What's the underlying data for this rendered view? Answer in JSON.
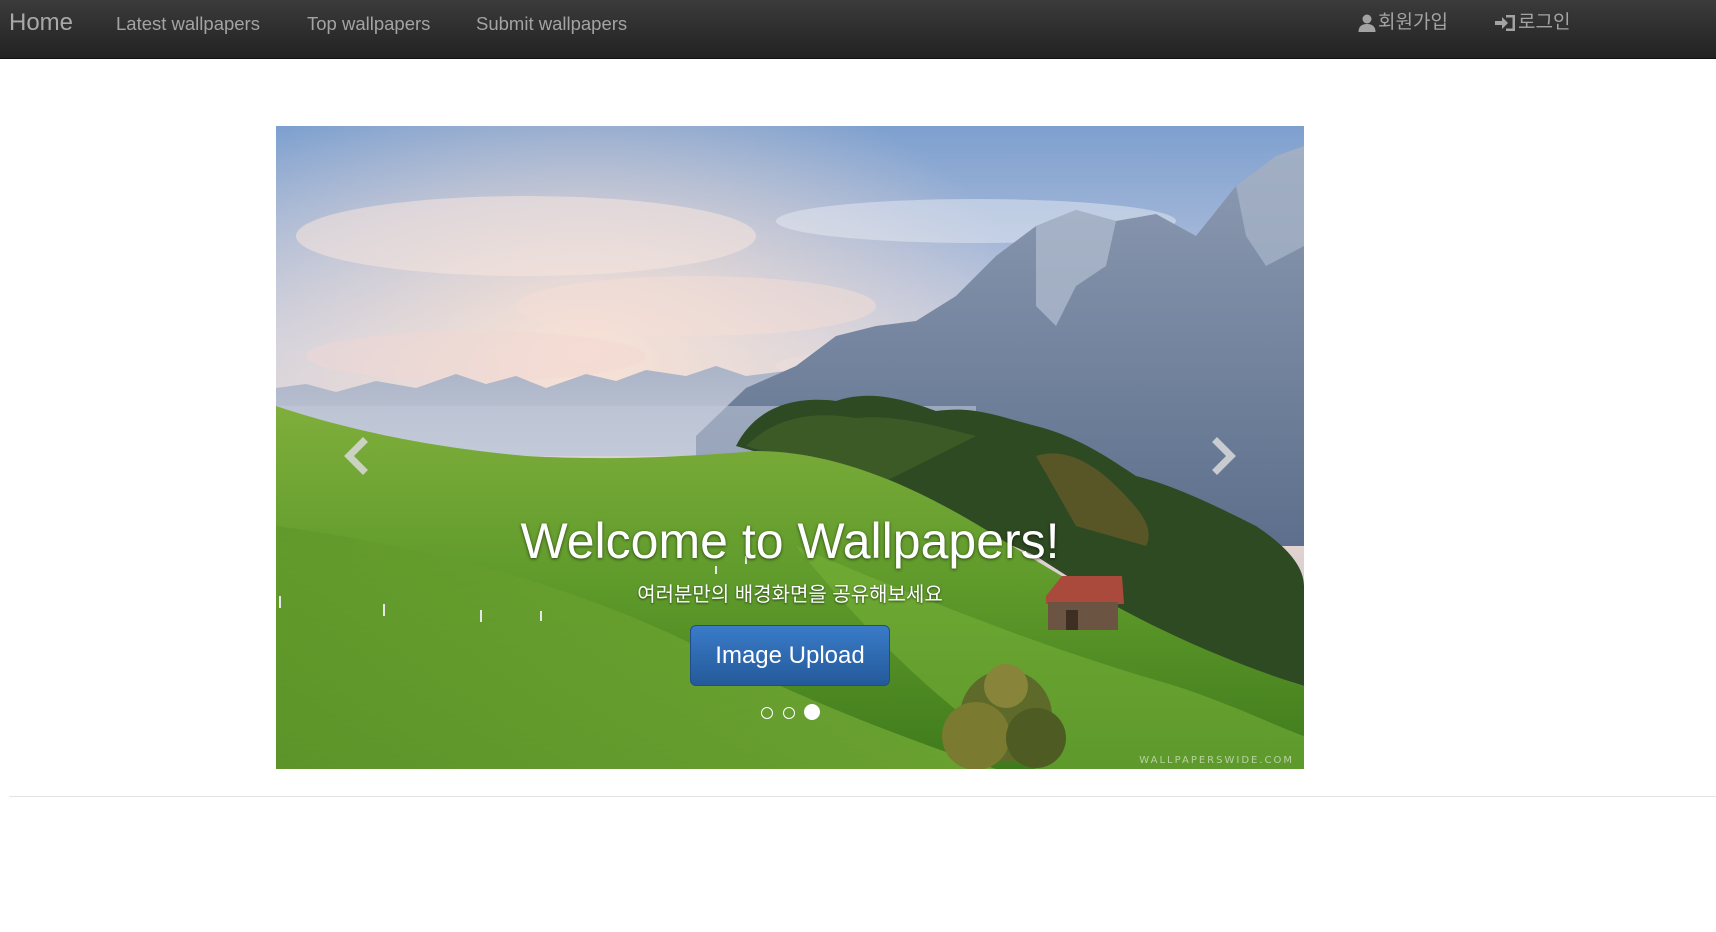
{
  "navbar": {
    "brand": "Home",
    "links": [
      "Latest wallpapers",
      "Top wallpapers",
      "Submit wallpapers"
    ],
    "signup": {
      "label": "회원가입",
      "icon": "user-icon"
    },
    "login": {
      "label": "로그인",
      "icon": "login-icon"
    }
  },
  "carousel": {
    "title": "Welcome to Wallpapers!",
    "subtitle": "여러분만의 배경화면을 공유해보세요",
    "button_label": "Image Upload",
    "slide_count": 3,
    "active_slide": 3,
    "watermark": "WALLPAPERSWIDE.COM",
    "prev_icon": "chevron-left-icon",
    "next_icon": "chevron-right-icon"
  },
  "colors": {
    "navbar_bg": "#2b2b2b",
    "nav_text": "#a3a3a3",
    "primary_button": "#2d6bb3"
  }
}
